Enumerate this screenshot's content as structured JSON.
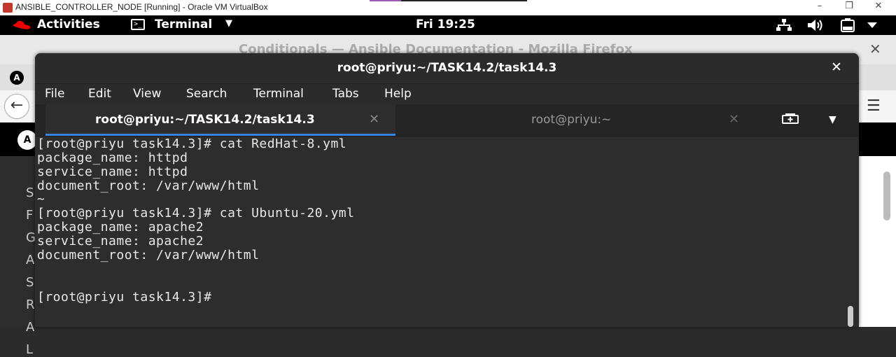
{
  "vbox": {
    "title": "ANSIBLE_CONTROLLER_NODE [Running] - Oracle VM VirtualBox",
    "minimize": "–",
    "restore": "❐",
    "close": "✕"
  },
  "topbar": {
    "activities": "Activities",
    "app_name": "Terminal",
    "app_caret": "▼",
    "clock": "Fri 19:25",
    "icons": [
      "network-icon",
      "volume-icon",
      "battery-icon",
      "system-menu-icon"
    ]
  },
  "firefox": {
    "title": "Conditionals — Ansible Documentation - Mozilla Firefox",
    "close": "✕",
    "tab_icon": "A",
    "back_icon": "←",
    "menu_icon": "☰",
    "site_logo": "A",
    "sidebar_letters": [
      "S",
      "F",
      "G",
      "A",
      "S",
      "R",
      "A",
      "L"
    ]
  },
  "terminal": {
    "window_title": "root@priyu:~/TASK14.2/task14.3",
    "close": "✕",
    "menu": [
      "File",
      "Edit",
      "View",
      "Search",
      "Terminal",
      "Tabs",
      "Help"
    ],
    "tabs": [
      {
        "label": "root@priyu:~/TASK14.2/task14.3",
        "close": "✕",
        "active": true
      },
      {
        "label": "root@priyu:~",
        "close": "✕",
        "active": false
      }
    ],
    "tabs_menu": "▼",
    "lines": [
      "[root@priyu task14.3]# cat RedHat-8.yml",
      "package_name: httpd",
      "service_name: httpd",
      "document_root: /var/www/html",
      "~",
      "[root@priyu task14.3]# cat Ubuntu-20.yml",
      "package_name: apache2",
      "service_name: apache2",
      "document_root: /var/www/html",
      "",
      "",
      "[root@priyu task14.3]#"
    ]
  },
  "colors": {
    "terminal_bg": "#2d2d2d",
    "tab_accent": "#3584e4",
    "topbar_bg": "#000000",
    "redhat_red": "#ee0000"
  }
}
